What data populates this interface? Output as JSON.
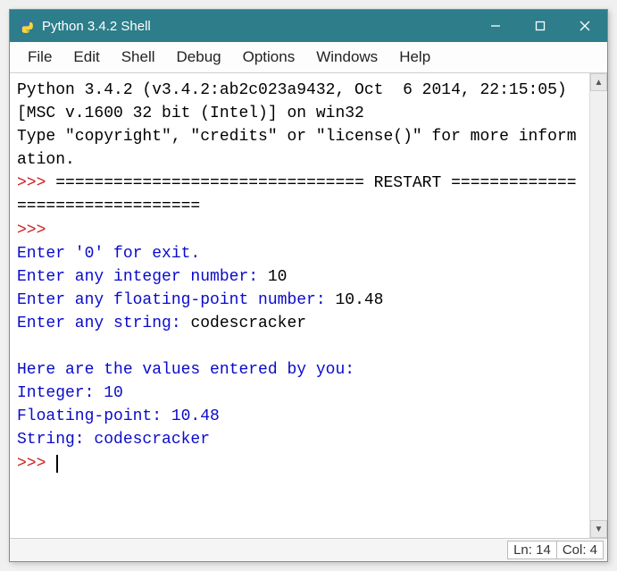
{
  "window": {
    "title": "Python 3.4.2 Shell"
  },
  "menubar": {
    "items": [
      "File",
      "Edit",
      "Shell",
      "Debug",
      "Options",
      "Windows",
      "Help"
    ]
  },
  "console": {
    "lines": [
      {
        "segments": [
          {
            "text": "Python 3.4.2 (v3.4.2:ab2c023a9432, Oct  6 2014, 22:15:05) [MSC v.1600 32 bit (Intel)] on win32",
            "color": "c-black"
          }
        ]
      },
      {
        "segments": [
          {
            "text": "Type \"copyright\", \"credits\" or \"license()\" for more information.",
            "color": "c-black"
          }
        ]
      },
      {
        "segments": [
          {
            "text": ">>> ",
            "color": "c-red"
          },
          {
            "text": "================================ RESTART ================================",
            "color": "c-black"
          }
        ]
      },
      {
        "segments": [
          {
            "text": ">>> ",
            "color": "c-red"
          }
        ]
      },
      {
        "segments": [
          {
            "text": "Enter '0' for exit.",
            "color": "c-blue"
          }
        ]
      },
      {
        "segments": [
          {
            "text": "Enter any integer number: ",
            "color": "c-blue"
          },
          {
            "text": "10",
            "color": "c-black"
          }
        ]
      },
      {
        "segments": [
          {
            "text": "Enter any floating-point number: ",
            "color": "c-blue"
          },
          {
            "text": "10.48",
            "color": "c-black"
          }
        ]
      },
      {
        "segments": [
          {
            "text": "Enter any string: ",
            "color": "c-blue"
          },
          {
            "text": "codescracker",
            "color": "c-black"
          }
        ]
      },
      {
        "segments": []
      },
      {
        "segments": [
          {
            "text": "Here are the values entered by you:",
            "color": "c-blue"
          }
        ]
      },
      {
        "segments": [
          {
            "text": "Integer: 10",
            "color": "c-blue"
          }
        ]
      },
      {
        "segments": [
          {
            "text": "Floating-point: 10.48",
            "color": "c-blue"
          }
        ]
      },
      {
        "segments": [
          {
            "text": "String: codescracker",
            "color": "c-blue"
          }
        ]
      },
      {
        "segments": [
          {
            "text": ">>> ",
            "color": "c-red"
          }
        ],
        "cursor": true
      }
    ]
  },
  "statusbar": {
    "ln_label": "Ln: 14",
    "col_label": "Col: 4"
  }
}
